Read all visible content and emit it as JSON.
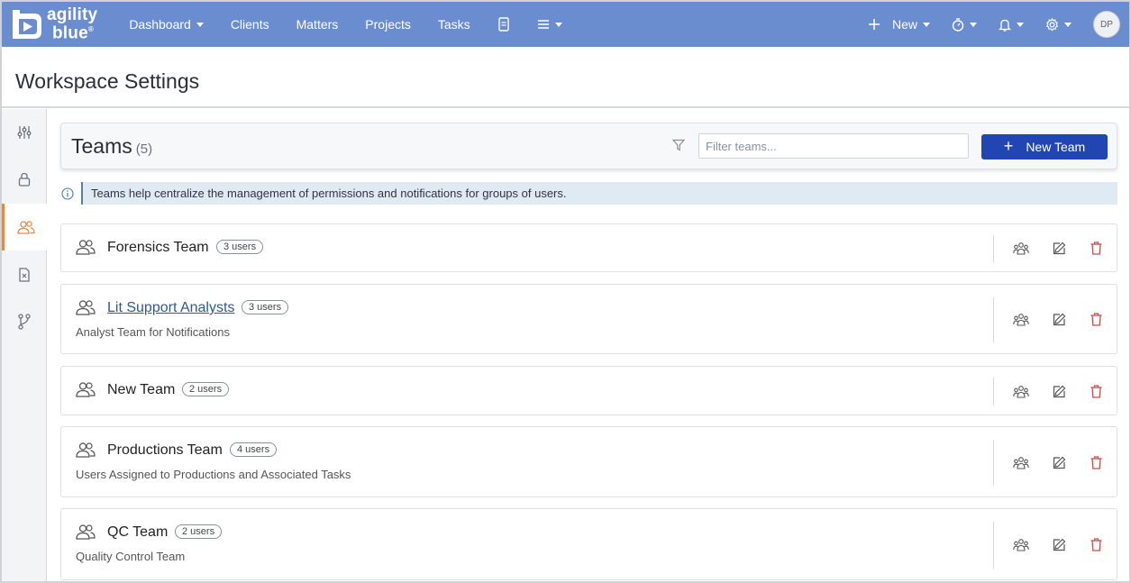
{
  "nav": {
    "logo_line1": "agility",
    "logo_line2": "blue",
    "logo_trademark": "®",
    "items": [
      {
        "label": "Dashboard",
        "caret": true
      },
      {
        "label": "Clients",
        "caret": false
      },
      {
        "label": "Matters",
        "caret": false
      },
      {
        "label": "Projects",
        "caret": false
      },
      {
        "label": "Tasks",
        "caret": false
      }
    ],
    "new_label": "New",
    "avatar_initials": "DP",
    "icons": [
      "document-icon",
      "menu-icon",
      "plus-icon",
      "timer-icon",
      "bell-icon",
      "gear-icon"
    ]
  },
  "page": {
    "title": "Workspace Settings"
  },
  "rail": {
    "items": [
      "sliders-icon",
      "lock-icon",
      "users-icon",
      "file-x-icon",
      "branch-icon"
    ],
    "active_index": 2,
    "active_color": "#e08a4a"
  },
  "teams": {
    "title": "Teams",
    "count": "(5)",
    "filter_placeholder": "Filter teams...",
    "new_team_label": "New Team",
    "info_text": "Teams help centralize the management of permissions and notifications for groups of users.",
    "list": [
      {
        "name": "Forensics Team",
        "users": "3 users",
        "description": "",
        "link": false
      },
      {
        "name": "Lit Support Analysts",
        "users": "3 users",
        "description": "Analyst Team for Notifications",
        "link": true
      },
      {
        "name": "New Team",
        "users": "2 users",
        "description": "",
        "link": false
      },
      {
        "name": "Productions Team",
        "users": "4 users",
        "description": "Users Assigned to Productions and Associated Tasks",
        "link": false
      },
      {
        "name": "QC Team",
        "users": "2 users",
        "description": "Quality Control Team",
        "link": false
      }
    ]
  },
  "colors": {
    "nav_bg": "#6a8dd0",
    "primary_button": "#2146b4",
    "info_bg": "#dfeaf3",
    "delete_icon": "#c0504d"
  }
}
